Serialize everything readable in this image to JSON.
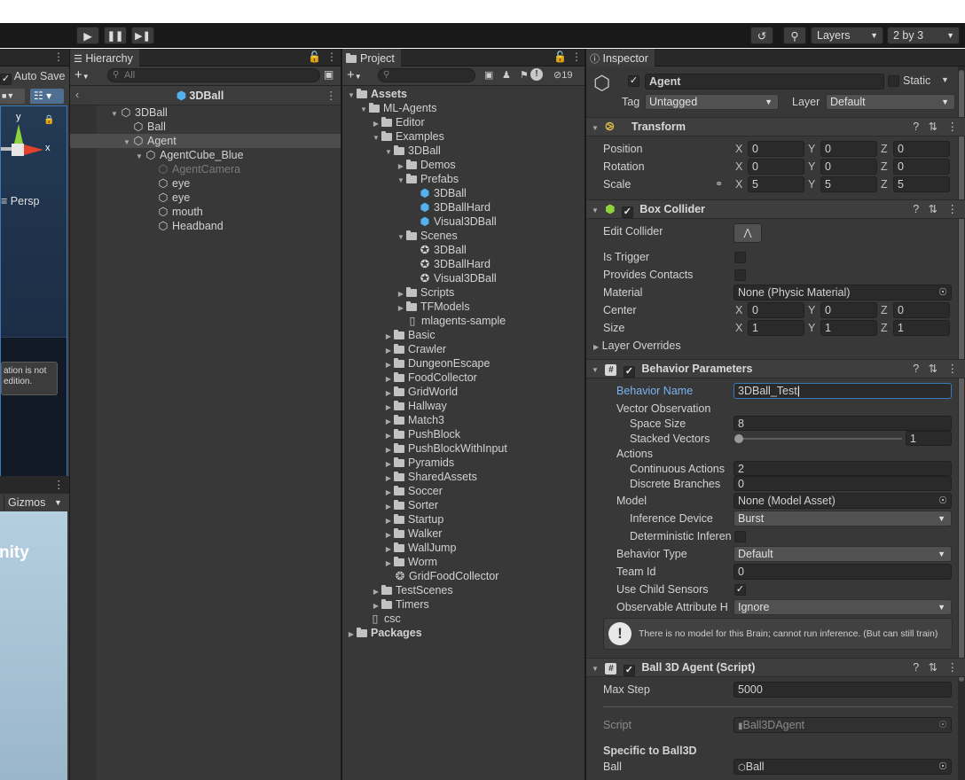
{
  "toolbar": {
    "play_icon": "play-icon",
    "pause_icon": "pause-icon",
    "step_icon": "step-icon",
    "history_icon": "history-icon",
    "search_icon": "search-icon",
    "layers_label": "Layers",
    "layout_label": "2 by 3"
  },
  "scene_panel": {
    "auto_save": "Auto Save",
    "axis_y": "y",
    "axis_x": "x",
    "persp": "Persp",
    "notice_line1": "ation is not",
    "notice_line2": "edition.",
    "gizmos": "Gizmos",
    "logo_text": "nity"
  },
  "hierarchy": {
    "tab_label": "Hierarchy",
    "search_placeholder": "All",
    "scene_name": "3DBall",
    "items": [
      {
        "label": "3DBall",
        "depth": 0,
        "expanded": true
      },
      {
        "label": "Ball",
        "depth": 1
      },
      {
        "label": "Agent",
        "depth": 1,
        "expanded": true,
        "selected": true
      },
      {
        "label": "AgentCube_Blue",
        "depth": 2,
        "expanded": true
      },
      {
        "label": "AgentCamera",
        "depth": 3,
        "disabled": true
      },
      {
        "label": "eye",
        "depth": 3
      },
      {
        "label": "eye",
        "depth": 3
      },
      {
        "label": "mouth",
        "depth": 3
      },
      {
        "label": "Headband",
        "depth": 3
      }
    ]
  },
  "project": {
    "tab_label": "Project",
    "hidden_count": "19",
    "items": [
      {
        "label": "Assets",
        "depth": 0,
        "type": "folder",
        "expanded": true,
        "bold": true
      },
      {
        "label": "ML-Agents",
        "depth": 1,
        "type": "folder",
        "expanded": true
      },
      {
        "label": "Editor",
        "depth": 2,
        "type": "folder"
      },
      {
        "label": "Examples",
        "depth": 2,
        "type": "folder",
        "expanded": true
      },
      {
        "label": "3DBall",
        "depth": 3,
        "type": "folder",
        "expanded": true
      },
      {
        "label": "Demos",
        "depth": 4,
        "type": "folder"
      },
      {
        "label": "Prefabs",
        "depth": 4,
        "type": "folder",
        "expanded": true
      },
      {
        "label": "3DBall",
        "depth": 5,
        "type": "prefab"
      },
      {
        "label": "3DBallHard",
        "depth": 5,
        "type": "prefab"
      },
      {
        "label": "Visual3DBall",
        "depth": 5,
        "type": "prefab"
      },
      {
        "label": "Scenes",
        "depth": 4,
        "type": "folder",
        "expanded": true
      },
      {
        "label": "3DBall",
        "depth": 5,
        "type": "scene"
      },
      {
        "label": "3DBallHard",
        "depth": 5,
        "type": "scene"
      },
      {
        "label": "Visual3DBall",
        "depth": 5,
        "type": "scene"
      },
      {
        "label": "Scripts",
        "depth": 4,
        "type": "folder"
      },
      {
        "label": "TFModels",
        "depth": 4,
        "type": "folder"
      },
      {
        "label": "mlagents-sample",
        "depth": 4,
        "type": "file"
      },
      {
        "label": "Basic",
        "depth": 3,
        "type": "folder"
      },
      {
        "label": "Crawler",
        "depth": 3,
        "type": "folder"
      },
      {
        "label": "DungeonEscape",
        "depth": 3,
        "type": "folder"
      },
      {
        "label": "FoodCollector",
        "depth": 3,
        "type": "folder"
      },
      {
        "label": "GridWorld",
        "depth": 3,
        "type": "folder"
      },
      {
        "label": "Hallway",
        "depth": 3,
        "type": "folder"
      },
      {
        "label": "Match3",
        "depth": 3,
        "type": "folder"
      },
      {
        "label": "PushBlock",
        "depth": 3,
        "type": "folder"
      },
      {
        "label": "PushBlockWithInput",
        "depth": 3,
        "type": "folder"
      },
      {
        "label": "Pyramids",
        "depth": 3,
        "type": "folder"
      },
      {
        "label": "SharedAssets",
        "depth": 3,
        "type": "folder"
      },
      {
        "label": "Soccer",
        "depth": 3,
        "type": "folder"
      },
      {
        "label": "Sorter",
        "depth": 3,
        "type": "folder"
      },
      {
        "label": "Startup",
        "depth": 3,
        "type": "folder"
      },
      {
        "label": "Walker",
        "depth": 3,
        "type": "folder"
      },
      {
        "label": "WallJump",
        "depth": 3,
        "type": "folder"
      },
      {
        "label": "Worm",
        "depth": 3,
        "type": "folder"
      },
      {
        "label": "GridFoodCollector",
        "depth": 3,
        "type": "settings"
      },
      {
        "label": "TestScenes",
        "depth": 2,
        "type": "folder"
      },
      {
        "label": "Timers",
        "depth": 2,
        "type": "folder"
      },
      {
        "label": "csc",
        "depth": 1,
        "type": "file"
      },
      {
        "label": "Packages",
        "depth": 0,
        "type": "folder",
        "bold": true
      }
    ]
  },
  "inspector": {
    "tab_label": "Inspector",
    "object_name": "Agent",
    "static_label": "Static",
    "tag_label": "Tag",
    "tag_value": "Untagged",
    "layer_label": "Layer",
    "layer_value": "Default",
    "transform": {
      "title": "Transform",
      "position_label": "Position",
      "rotation_label": "Rotation",
      "scale_label": "Scale",
      "position": {
        "x": "0",
        "y": "0",
        "z": "0"
      },
      "rotation": {
        "x": "0",
        "y": "0",
        "z": "0"
      },
      "scale": {
        "x": "5",
        "y": "5",
        "z": "5"
      }
    },
    "box_collider": {
      "title": "Box Collider",
      "edit_collider": "Edit Collider",
      "is_trigger": "Is Trigger",
      "provides_contacts": "Provides Contacts",
      "material_label": "Material",
      "material_value": "None (Physic Material)",
      "center_label": "Center",
      "center": {
        "x": "0",
        "y": "0",
        "z": "0"
      },
      "size_label": "Size",
      "size": {
        "x": "1",
        "y": "1",
        "z": "1"
      },
      "layer_overrides": "Layer Overrides"
    },
    "behavior": {
      "title": "Behavior Parameters",
      "behavior_name_label": "Behavior Name",
      "behavior_name_value": "3DBall_Test",
      "vector_obs_label": "Vector Observation",
      "space_size_label": "Space Size",
      "space_size_value": "8",
      "stacked_vectors_label": "Stacked Vectors",
      "stacked_vectors_value": "1",
      "actions_label": "Actions",
      "continuous_actions_label": "Continuous Actions",
      "continuous_actions_value": "2",
      "discrete_branches_label": "Discrete Branches",
      "discrete_branches_value": "0",
      "model_label": "Model",
      "model_value": "None (Model Asset)",
      "inference_device_label": "Inference Device",
      "inference_device_value": "Burst",
      "deterministic_label": "Deterministic Inferen",
      "behavior_type_label": "Behavior Type",
      "behavior_type_value": "Default",
      "team_id_label": "Team Id",
      "team_id_value": "0",
      "use_child_sensors_label": "Use Child Sensors",
      "observable_label": "Observable Attribute H",
      "observable_value": "Ignore",
      "warning_text": "There is no model for this Brain; cannot run inference. (But can still train)"
    },
    "ball_agent": {
      "title": "Ball 3D Agent (Script)",
      "max_step_label": "Max Step",
      "max_step_value": "5000",
      "script_label": "Script",
      "script_value": "Ball3DAgent",
      "specific_header": "Specific to Ball3D",
      "ball_label": "Ball",
      "ball_value": "Ball"
    }
  },
  "colors": {
    "panel_bg": "#383838",
    "selected_row": "#4d4d4d",
    "accent_blue": "#55b0f0",
    "focus_blue": "#3a79bb",
    "scene_blue": "#2d4a6a"
  }
}
